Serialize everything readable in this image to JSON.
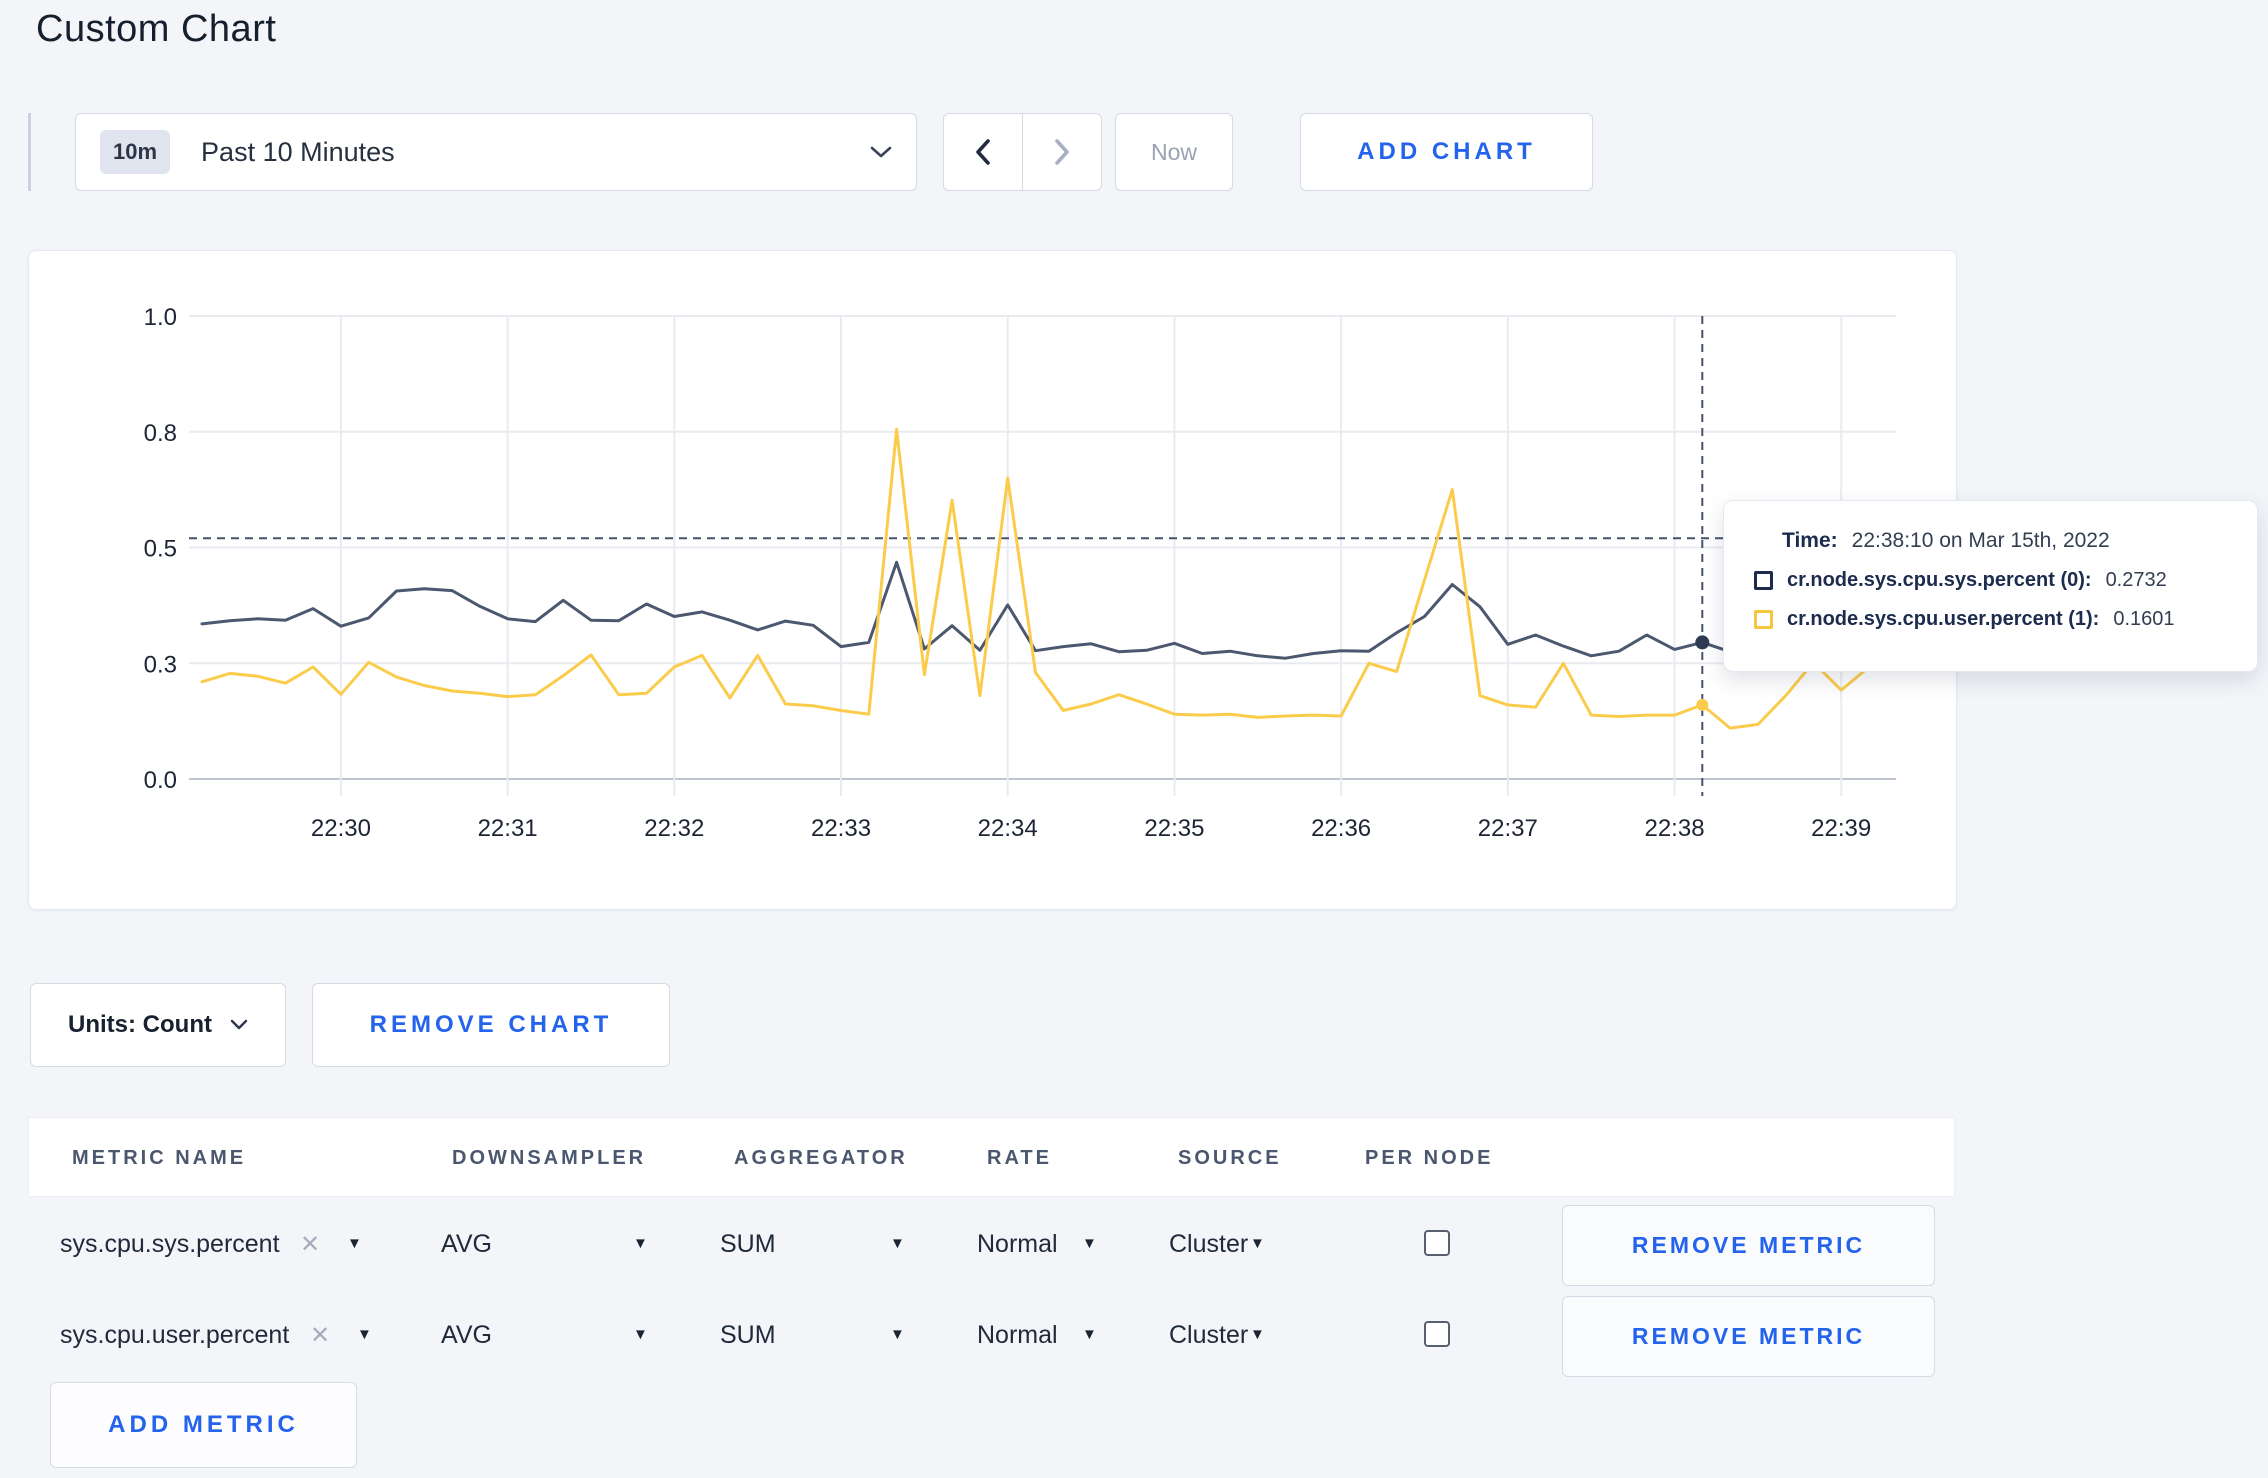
{
  "page": {
    "title": "Custom Chart"
  },
  "toolbar": {
    "range_badge": "10m",
    "range_label": "Past 10 Minutes",
    "now_label": "Now",
    "add_chart_label": "ADD CHART",
    "accent_color": "#2463eb"
  },
  "chart_data": {
    "type": "line",
    "title": "",
    "xlabel": "",
    "ylabel": "",
    "ylim": [
      0,
      1
    ],
    "grid": true,
    "y_ticks": [
      {
        "label": "1.0",
        "value": 1.0
      },
      {
        "label": "0.8",
        "value": 0.75
      },
      {
        "label": "0.5",
        "value": 0.5
      },
      {
        "label": "0.3",
        "value": 0.25
      },
      {
        "label": "0.0",
        "value": 0.0
      }
    ],
    "x_start_time": "22:29:10",
    "x_interval_seconds": 10,
    "x_ticks": [
      {
        "label": "22:30",
        "index": 5
      },
      {
        "label": "22:31",
        "index": 11
      },
      {
        "label": "22:32",
        "index": 17
      },
      {
        "label": "22:33",
        "index": 23
      },
      {
        "label": "22:34",
        "index": 29
      },
      {
        "label": "22:35",
        "index": 35
      },
      {
        "label": "22:36",
        "index": 41
      },
      {
        "label": "22:37",
        "index": 47
      },
      {
        "label": "22:38",
        "index": 53
      },
      {
        "label": "22:39",
        "index": 59
      }
    ],
    "hover_line_value": 0.52,
    "crosshair_index": 54,
    "series": [
      {
        "name": "cr.node.sys.cpu.sys.percent",
        "color": "#4c586f",
        "values": [
          0.335,
          0.342,
          0.346,
          0.343,
          0.368,
          0.33,
          0.348,
          0.406,
          0.411,
          0.407,
          0.373,
          0.346,
          0.34,
          0.386,
          0.343,
          0.342,
          0.378,
          0.351,
          0.361,
          0.343,
          0.322,
          0.341,
          0.332,
          0.286,
          0.295,
          0.468,
          0.281,
          0.331,
          0.278,
          0.376,
          0.277,
          0.286,
          0.292,
          0.275,
          0.278,
          0.293,
          0.271,
          0.276,
          0.266,
          0.261,
          0.271,
          0.277,
          0.276,
          0.316,
          0.351,
          0.42,
          0.372,
          0.291,
          0.311,
          0.287,
          0.266,
          0.276,
          0.311,
          0.28,
          0.295,
          0.275,
          0.273,
          0.291,
          0.293,
          0.276,
          0.278
        ]
      },
      {
        "name": "cr.node.sys.cpu.user.percent",
        "color": "#fbcc4b",
        "values": [
          0.21,
          0.228,
          0.222,
          0.207,
          0.242,
          0.183,
          0.252,
          0.22,
          0.202,
          0.19,
          0.185,
          0.178,
          0.182,
          0.223,
          0.268,
          0.182,
          0.185,
          0.242,
          0.267,
          0.175,
          0.267,
          0.162,
          0.158,
          0.148,
          0.14,
          0.755,
          0.225,
          0.602,
          0.18,
          0.65,
          0.23,
          0.148,
          0.162,
          0.182,
          0.162,
          0.14,
          0.138,
          0.14,
          0.133,
          0.136,
          0.138,
          0.136,
          0.25,
          0.232,
          0.43,
          0.625,
          0.18,
          0.16,
          0.155,
          0.25,
          0.138,
          0.135,
          0.138,
          0.138,
          0.16,
          0.11,
          0.118,
          0.18,
          0.252,
          0.192,
          0.242
        ]
      }
    ]
  },
  "tooltip": {
    "time_label": "Time:",
    "time_value": "22:38:10 on Mar 15th, 2022",
    "series": [
      {
        "label": "cr.node.sys.cpu.sys.percent (0):",
        "value": "0.2732",
        "color": "#1c2b4a"
      },
      {
        "label": "cr.node.sys.cpu.user.percent (1):",
        "value": "0.1601",
        "color": "#f5c53d"
      }
    ]
  },
  "units_row": {
    "units_label": "Units: Count",
    "remove_chart_label": "REMOVE CHART"
  },
  "table": {
    "headers": [
      "METRIC NAME",
      "DOWNSAMPLER",
      "AGGREGATOR",
      "RATE",
      "SOURCE",
      "PER NODE"
    ],
    "rows": [
      {
        "metric": "sys.cpu.sys.percent",
        "downsampler": "AVG",
        "aggregator": "SUM",
        "rate": "Normal",
        "source": "Cluster",
        "per_node_checked": false,
        "remove_label": "REMOVE METRIC"
      },
      {
        "metric": "sys.cpu.user.percent",
        "downsampler": "AVG",
        "aggregator": "SUM",
        "rate": "Normal",
        "source": "Cluster",
        "per_node_checked": false,
        "remove_label": "REMOVE METRIC"
      }
    ],
    "add_metric_label": "ADD METRIC"
  }
}
